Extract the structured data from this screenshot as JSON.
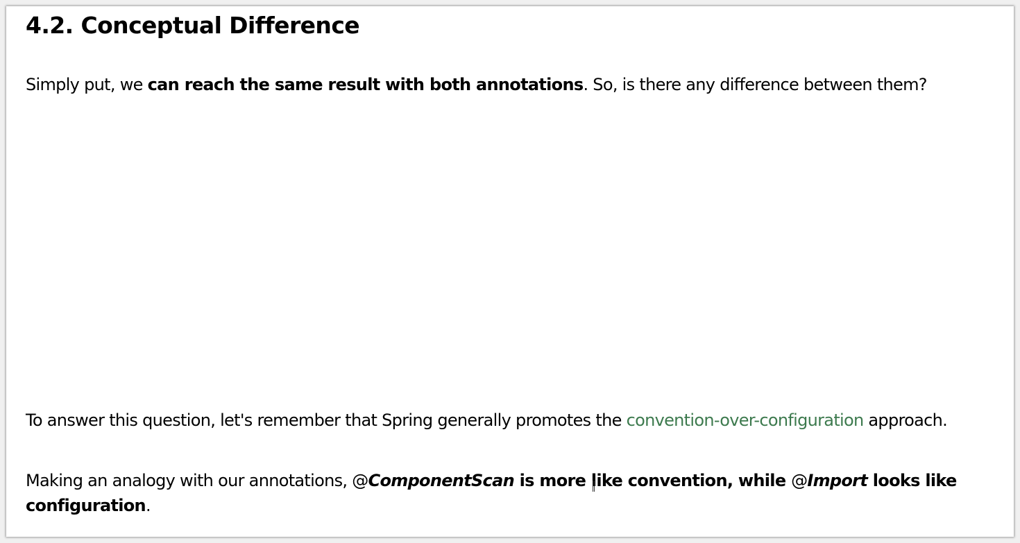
{
  "section": {
    "heading": "4.2. Conceptual Difference"
  },
  "paragraph1": {
    "lead": "Simply put, we ",
    "bold": "can reach the same result with both annotations",
    "tail": ". So, is there any difference between them?"
  },
  "paragraph2": {
    "lead": "To answer this question, let's remember that Spring generally promotes the ",
    "link": "convention-over-configuration",
    "tail": " approach."
  },
  "paragraph3": {
    "lead": "Making an analogy with our annotations, ",
    "at1": "@",
    "annotation1": "ComponentScan",
    "middle": " is more like convention, while ",
    "at2": "@",
    "annotation2": "Import",
    "bold_tail": " looks like configuration",
    "end": "."
  }
}
